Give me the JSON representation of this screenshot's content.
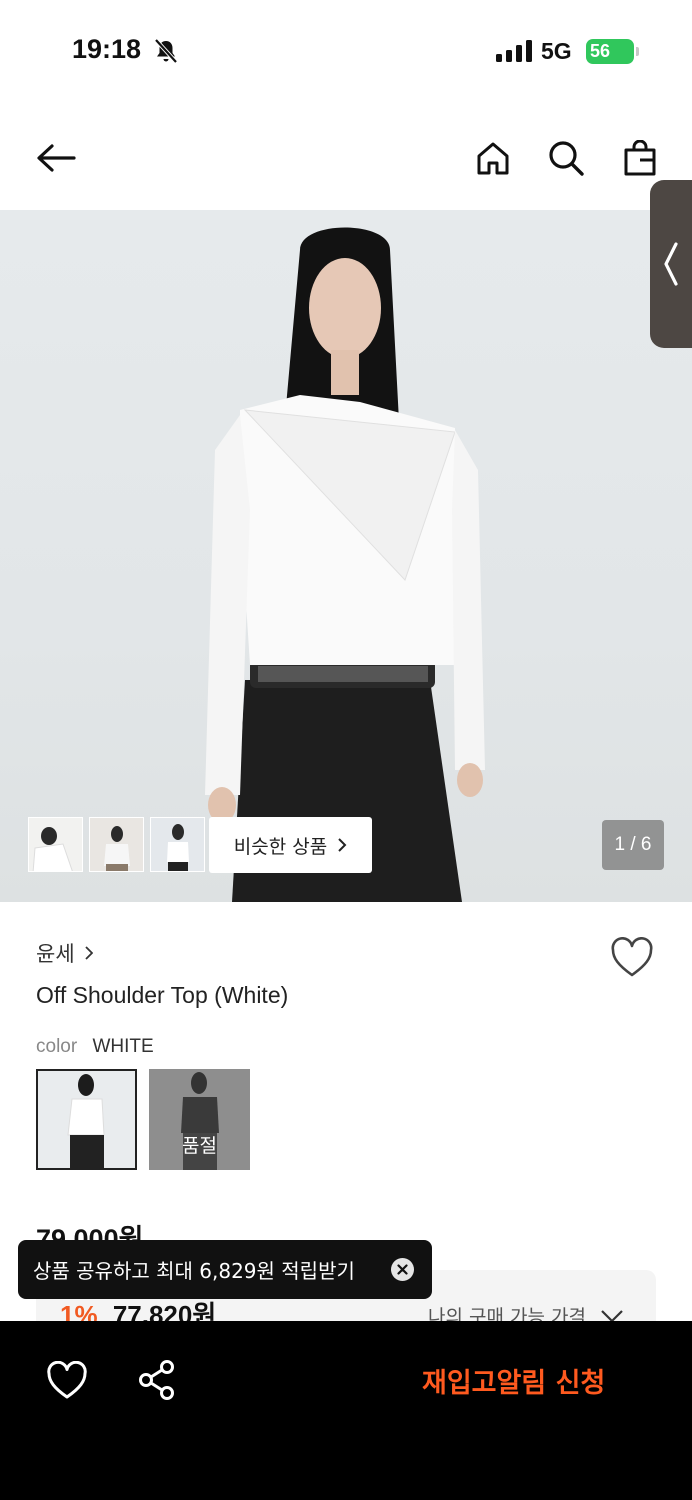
{
  "status_bar": {
    "time": "19:18",
    "network": "5G",
    "battery": "56"
  },
  "nav": {
    "icons": [
      "back-arrow-icon",
      "home-icon",
      "search-icon",
      "shopping-bag-icon"
    ]
  },
  "gallery": {
    "similar_label": "비슷한 상품",
    "page_counter": "1 / 6",
    "thumbnail_count": 3
  },
  "product": {
    "brand": "윤세",
    "name": "Off Shoulder Top (White)",
    "color_label": "color",
    "color_value": "WHITE",
    "swatches": [
      {
        "color": "white",
        "selected": true
      },
      {
        "color": "black",
        "status": "품절"
      }
    ],
    "price": "79,000원",
    "discount_rate": "1%",
    "discount_price": "77,820원",
    "my_price_label": "나의 구매 가능 가격"
  },
  "toast": {
    "message": "상품 공유하고 최대 6,829원 적립받기"
  },
  "bottom_bar": {
    "restock_label": "재입고알림 신청"
  },
  "colors": {
    "accent_orange": "#ff5a1f",
    "discount_orange": "#f15a22",
    "battery_green": "#30c75c"
  }
}
